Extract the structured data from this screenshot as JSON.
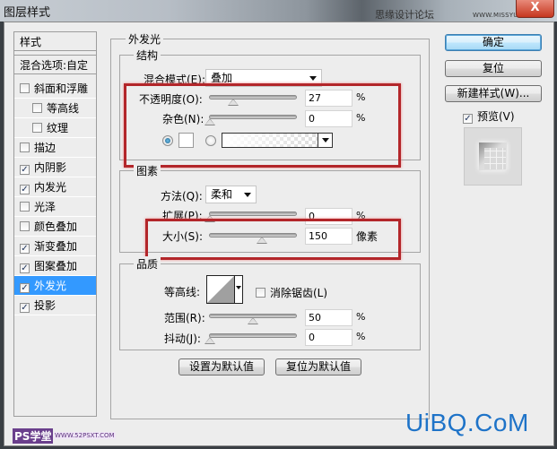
{
  "window": {
    "title": "图层样式",
    "close_label": "X",
    "watermark_top": "思缘设计论坛",
    "watermark_top_url": "WWW.MISSYUAN.COM"
  },
  "styles_list": {
    "header": "样式",
    "blend_options": "混合选项:自定",
    "items": [
      {
        "label": "斜面和浮雕",
        "checked": false,
        "indent": false,
        "selected": false
      },
      {
        "label": "等高线",
        "checked": false,
        "indent": true,
        "selected": false
      },
      {
        "label": "纹理",
        "checked": false,
        "indent": true,
        "selected": false
      },
      {
        "label": "描边",
        "checked": false,
        "indent": false,
        "selected": false
      },
      {
        "label": "内阴影",
        "checked": true,
        "indent": false,
        "selected": false
      },
      {
        "label": "内发光",
        "checked": true,
        "indent": false,
        "selected": false
      },
      {
        "label": "光泽",
        "checked": false,
        "indent": false,
        "selected": false
      },
      {
        "label": "颜色叠加",
        "checked": false,
        "indent": false,
        "selected": false
      },
      {
        "label": "渐变叠加",
        "checked": true,
        "indent": false,
        "selected": false
      },
      {
        "label": "图案叠加",
        "checked": true,
        "indent": false,
        "selected": false
      },
      {
        "label": "外发光",
        "checked": true,
        "indent": false,
        "selected": true
      },
      {
        "label": "投影",
        "checked": true,
        "indent": false,
        "selected": false
      }
    ]
  },
  "outer_glow": {
    "title": "外发光",
    "structure": {
      "title": "结构",
      "blend_mode_label": "混合模式(E):",
      "blend_mode_value": "叠加",
      "opacity_label": "不透明度(O):",
      "opacity_value": "27",
      "opacity_unit": "%",
      "opacity_slider_percent": 27,
      "noise_label": "杂色(N):",
      "noise_value": "0",
      "noise_unit": "%",
      "noise_slider_percent": 0,
      "color_mode_selected": "solid",
      "solid_color": "#ffffff"
    },
    "elements": {
      "title": "图素",
      "technique_label": "方法(Q):",
      "technique_value": "柔和",
      "spread_label": "扩展(P):",
      "spread_value": "0",
      "spread_unit": "%",
      "spread_slider_percent": 0,
      "size_label": "大小(S):",
      "size_value": "150",
      "size_unit": "像素",
      "size_slider_percent": 60
    },
    "quality": {
      "title": "品质",
      "contour_label": "等高线:",
      "anti_alias_label": "消除锯齿(L)",
      "anti_alias_checked": false,
      "range_label": "范围(R):",
      "range_value": "50",
      "range_unit": "%",
      "range_slider_percent": 50,
      "jitter_label": "抖动(J):",
      "jitter_value": "0",
      "jitter_unit": "%",
      "jitter_slider_percent": 0
    },
    "make_default_label": "设置为默认值",
    "reset_default_label": "复位为默认值"
  },
  "actions": {
    "ok_label": "确定",
    "reset_label": "复位",
    "new_style_label": "新建样式(W)...",
    "preview_label": "预览(V)",
    "preview_checked": true
  },
  "watermarks": {
    "bottom_left": "PS学堂",
    "bottom_left_url": "WWW.52PSXT.COM",
    "bottom_right": "UiBQ.CoM"
  },
  "colors": {
    "highlight_box": "#b3262a",
    "selection": "#3399ff",
    "brand_watermark": "#1e73c8"
  }
}
